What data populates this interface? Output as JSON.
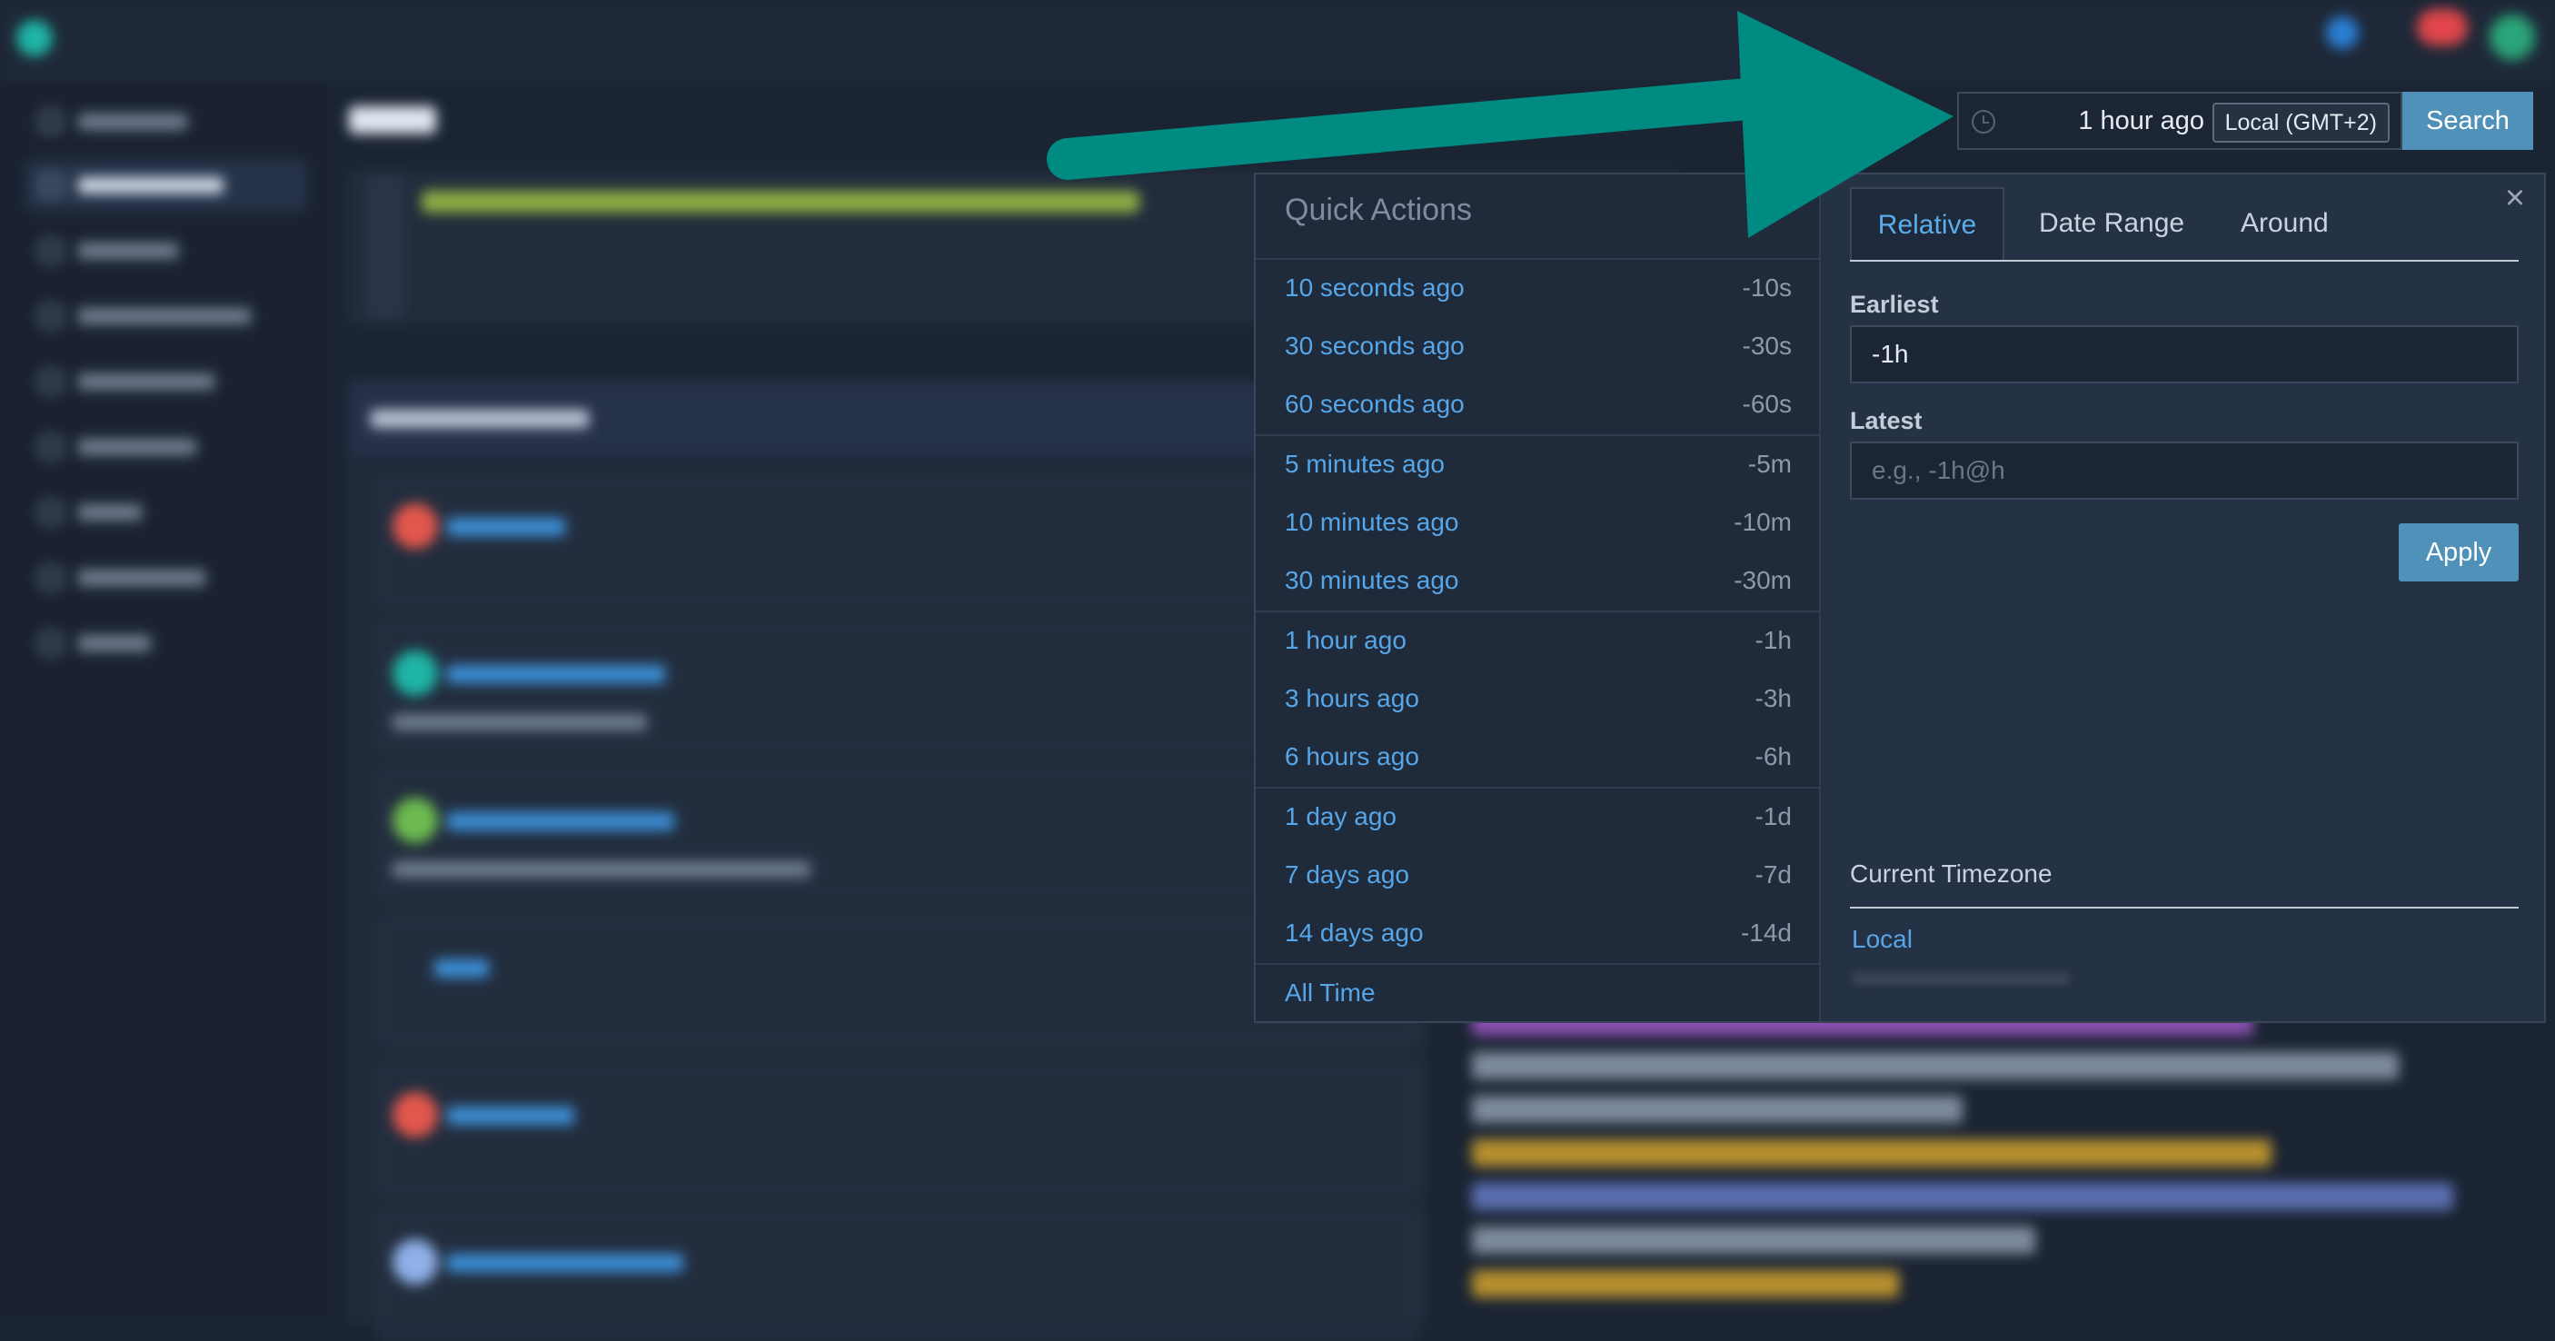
{
  "time_picker": {
    "value": "1 hour ago",
    "timezone_badge": "Local (GMT+2)",
    "search_label": "Search"
  },
  "quick_actions": {
    "title": "Quick Actions",
    "groups": [
      [
        {
          "label": "10 seconds ago",
          "code": "-10s"
        },
        {
          "label": "30 seconds ago",
          "code": "-30s"
        },
        {
          "label": "60 seconds ago",
          "code": "-60s"
        }
      ],
      [
        {
          "label": "5 minutes ago",
          "code": "-5m"
        },
        {
          "label": "10 minutes ago",
          "code": "-10m"
        },
        {
          "label": "30 minutes ago",
          "code": "-30m"
        }
      ],
      [
        {
          "label": "1 hour ago",
          "code": "-1h"
        },
        {
          "label": "3 hours ago",
          "code": "-3h"
        },
        {
          "label": "6 hours ago",
          "code": "-6h"
        }
      ],
      [
        {
          "label": "1 day ago",
          "code": "-1d"
        },
        {
          "label": "7 days ago",
          "code": "-7d"
        },
        {
          "label": "14 days ago",
          "code": "-14d"
        }
      ]
    ],
    "all_time": "All Time"
  },
  "relative_panel": {
    "tabs": [
      "Relative",
      "Date Range",
      "Around"
    ],
    "active_tab": "Relative",
    "earliest_label": "Earliest",
    "earliest_value": "-1h",
    "latest_label": "Latest",
    "latest_placeholder": "e.g., -1h@h",
    "apply_label": "Apply",
    "timezone_heading": "Current Timezone",
    "timezone_value": "Local",
    "close_icon": "close-icon"
  },
  "colors": {
    "accent_teal": "#008b82",
    "link_blue": "#56a6e8",
    "button_blue": "#4f91b8"
  }
}
